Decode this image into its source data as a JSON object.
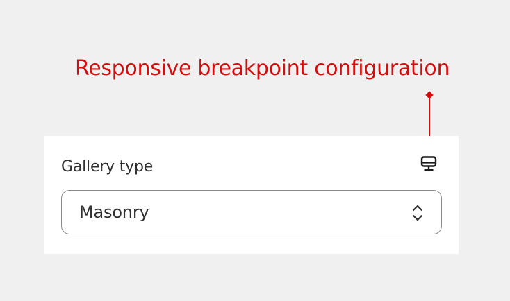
{
  "annotation": {
    "text": "Responsive breakpoint configuration",
    "color": "#d40d0d"
  },
  "field": {
    "label": "Gallery type",
    "selected_value": "Masonry",
    "breakpoint_icon": "desktop-monitor-icon",
    "chevron_icon": "select-up-down-chevron-icon"
  },
  "colors": {
    "background": "#f0f0f0",
    "panel": "#ffffff",
    "text": "#303030",
    "border": "#8a8a8a"
  }
}
